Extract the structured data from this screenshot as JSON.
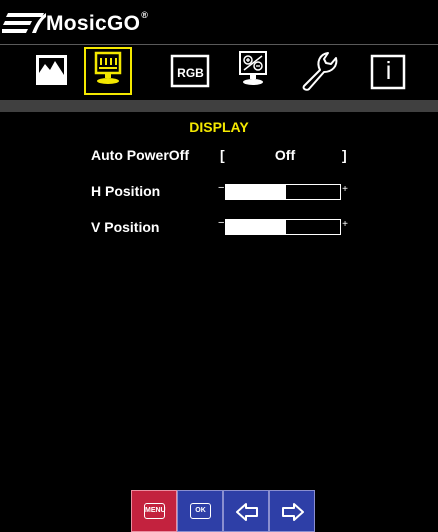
{
  "brand": {
    "name": "MosicGO",
    "mark": "®"
  },
  "tabs": [
    {
      "id": "picture",
      "icon": "mountain-picture-icon",
      "active": false
    },
    {
      "id": "display",
      "icon": "monitor-display-icon",
      "active": true
    },
    {
      "id": "color",
      "icon": "rgb-icon",
      "label": "RGB",
      "active": false
    },
    {
      "id": "image-setup",
      "icon": "monitor-adjust-icon",
      "active": false
    },
    {
      "id": "tools",
      "icon": "wrench-icon",
      "active": false
    },
    {
      "id": "information",
      "icon": "info-icon",
      "label": "i",
      "active": false
    }
  ],
  "section": {
    "title": "DISPLAY"
  },
  "settings": {
    "auto_poweroff": {
      "label": "Auto PowerOff",
      "open": "[",
      "value": "Off",
      "close": "]"
    },
    "h_position": {
      "label": "H Position",
      "minus": "−",
      "plus": "+",
      "level": 0.53
    },
    "v_position": {
      "label": "V Position",
      "minus": "−",
      "plus": "+",
      "level": 0.53
    }
  },
  "buttons": {
    "menu": "MENU",
    "ok": "OK",
    "left": "left-arrow-icon",
    "right": "right-arrow-icon"
  },
  "colors": {
    "accent_yellow": "#f4e800",
    "menu_red": "#c3223e",
    "nav_blue": "#2e3fa7",
    "background": "#000000"
  }
}
